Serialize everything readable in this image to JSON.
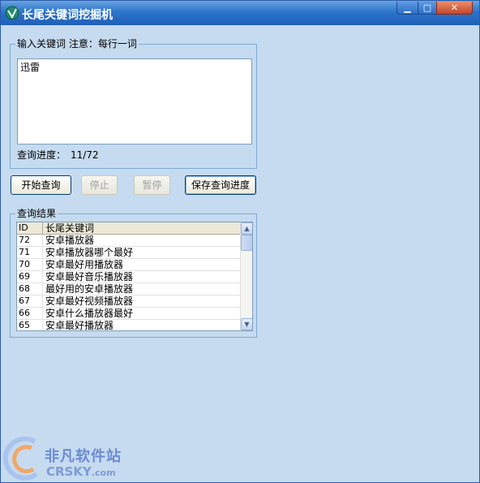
{
  "window": {
    "title": "长尾关键词挖掘机"
  },
  "titlebar": {
    "minimize": "▁",
    "maximize": "□",
    "close": "✕"
  },
  "input_group": {
    "label": "输入关键词 注意：每行一词",
    "textarea_value": "迅雷",
    "progress_label": "查询进度：",
    "progress_value": "11/72"
  },
  "buttons": {
    "start": "开始查询",
    "stop": "停止",
    "pause": "暂停",
    "save": "保存查询进度"
  },
  "results": {
    "label": "查询结果",
    "columns": [
      "ID",
      "长尾关键词"
    ],
    "rows": [
      {
        "id": "72",
        "keyword": "安卓播放器"
      },
      {
        "id": "71",
        "keyword": "安卓播放器哪个最好"
      },
      {
        "id": "70",
        "keyword": "安卓最好用播放器"
      },
      {
        "id": "69",
        "keyword": "安卓最好音乐播放器"
      },
      {
        "id": "68",
        "keyword": "最好用的安卓播放器"
      },
      {
        "id": "67",
        "keyword": "安卓最好视频播放器"
      },
      {
        "id": "66",
        "keyword": "安卓什么播放器最好"
      },
      {
        "id": "65",
        "keyword": "安卓最好播放器"
      }
    ]
  },
  "watermark": {
    "line1": "非凡软件站",
    "line2": "CRSKY",
    "line2_suffix": ".com"
  },
  "colors": {
    "window_bg": "#c6dbef",
    "titlebar": "#2c74cc",
    "group_border": "#7faad6"
  }
}
